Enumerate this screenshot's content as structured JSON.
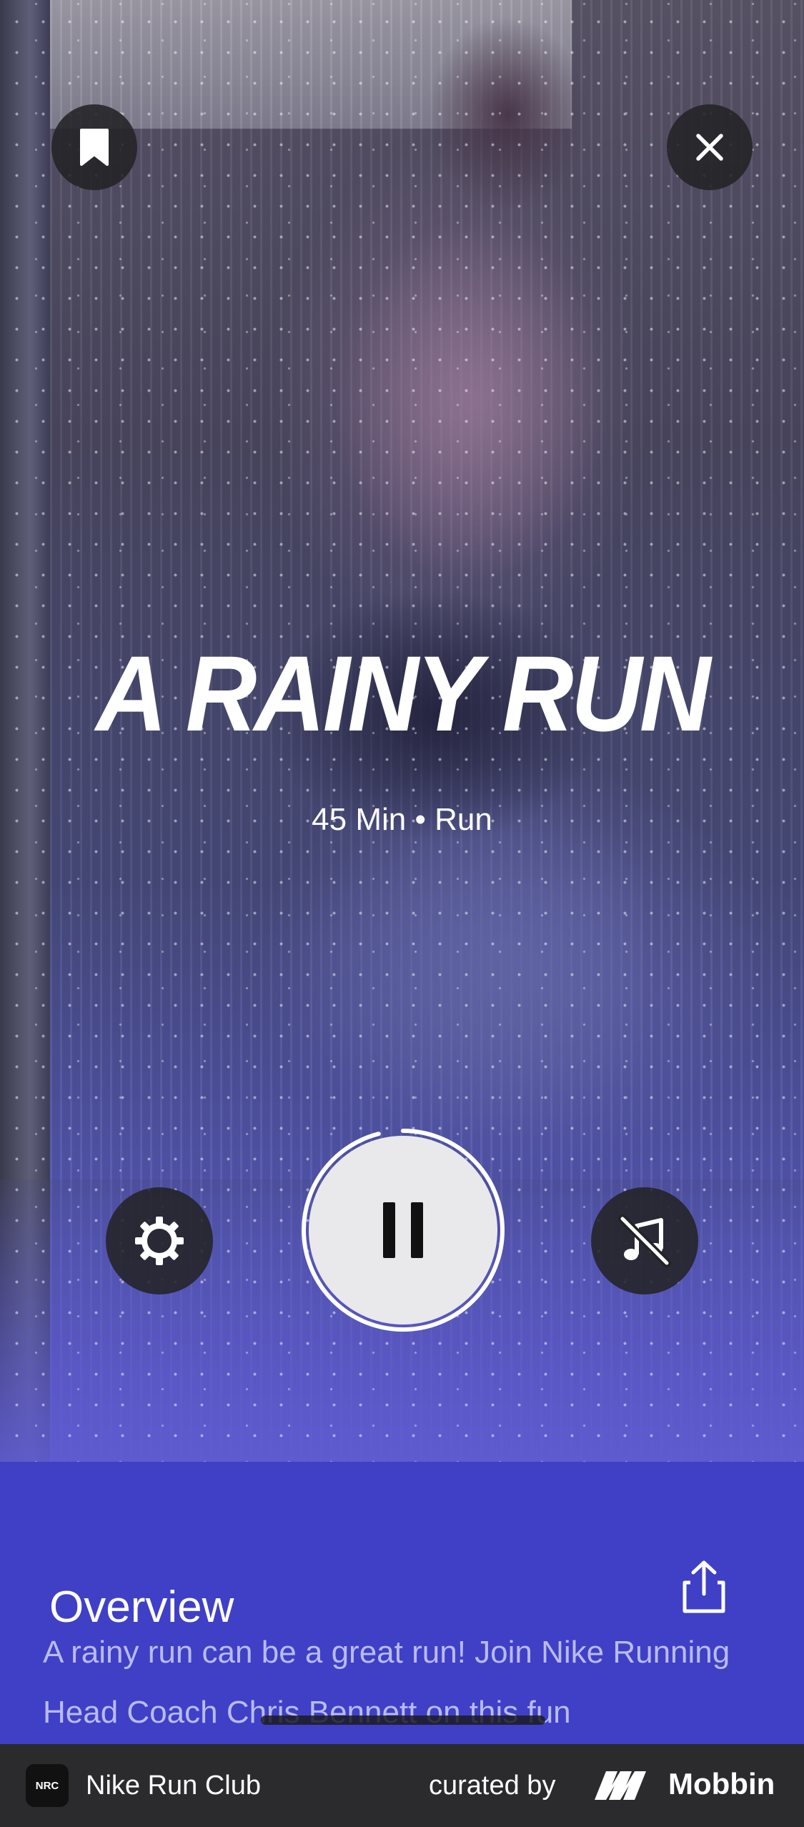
{
  "hero": {
    "title": "A RAINY RUN",
    "subtitle": "45 Min • Run",
    "icons": {
      "bookmark": "bookmark-icon",
      "close": "close-icon",
      "settings": "gear-icon",
      "pause": "pause-icon",
      "music_off": "music-off-icon"
    },
    "progress_ring_fraction": 0.96
  },
  "overview": {
    "title": "Overview",
    "description": "A rainy run can be a great run! Join Nike Running Head Coach Chris Bennett on this fun",
    "share_icon": "share-icon"
  },
  "footer": {
    "app_icon_text": "NRC",
    "app_name": "Nike Run Club",
    "curated_label": "curated by",
    "brand": "Mobbin"
  },
  "colors": {
    "overview_bg": "#3f40c6",
    "footer_bg": "#2b2b2e",
    "button_bg": "#232326"
  }
}
